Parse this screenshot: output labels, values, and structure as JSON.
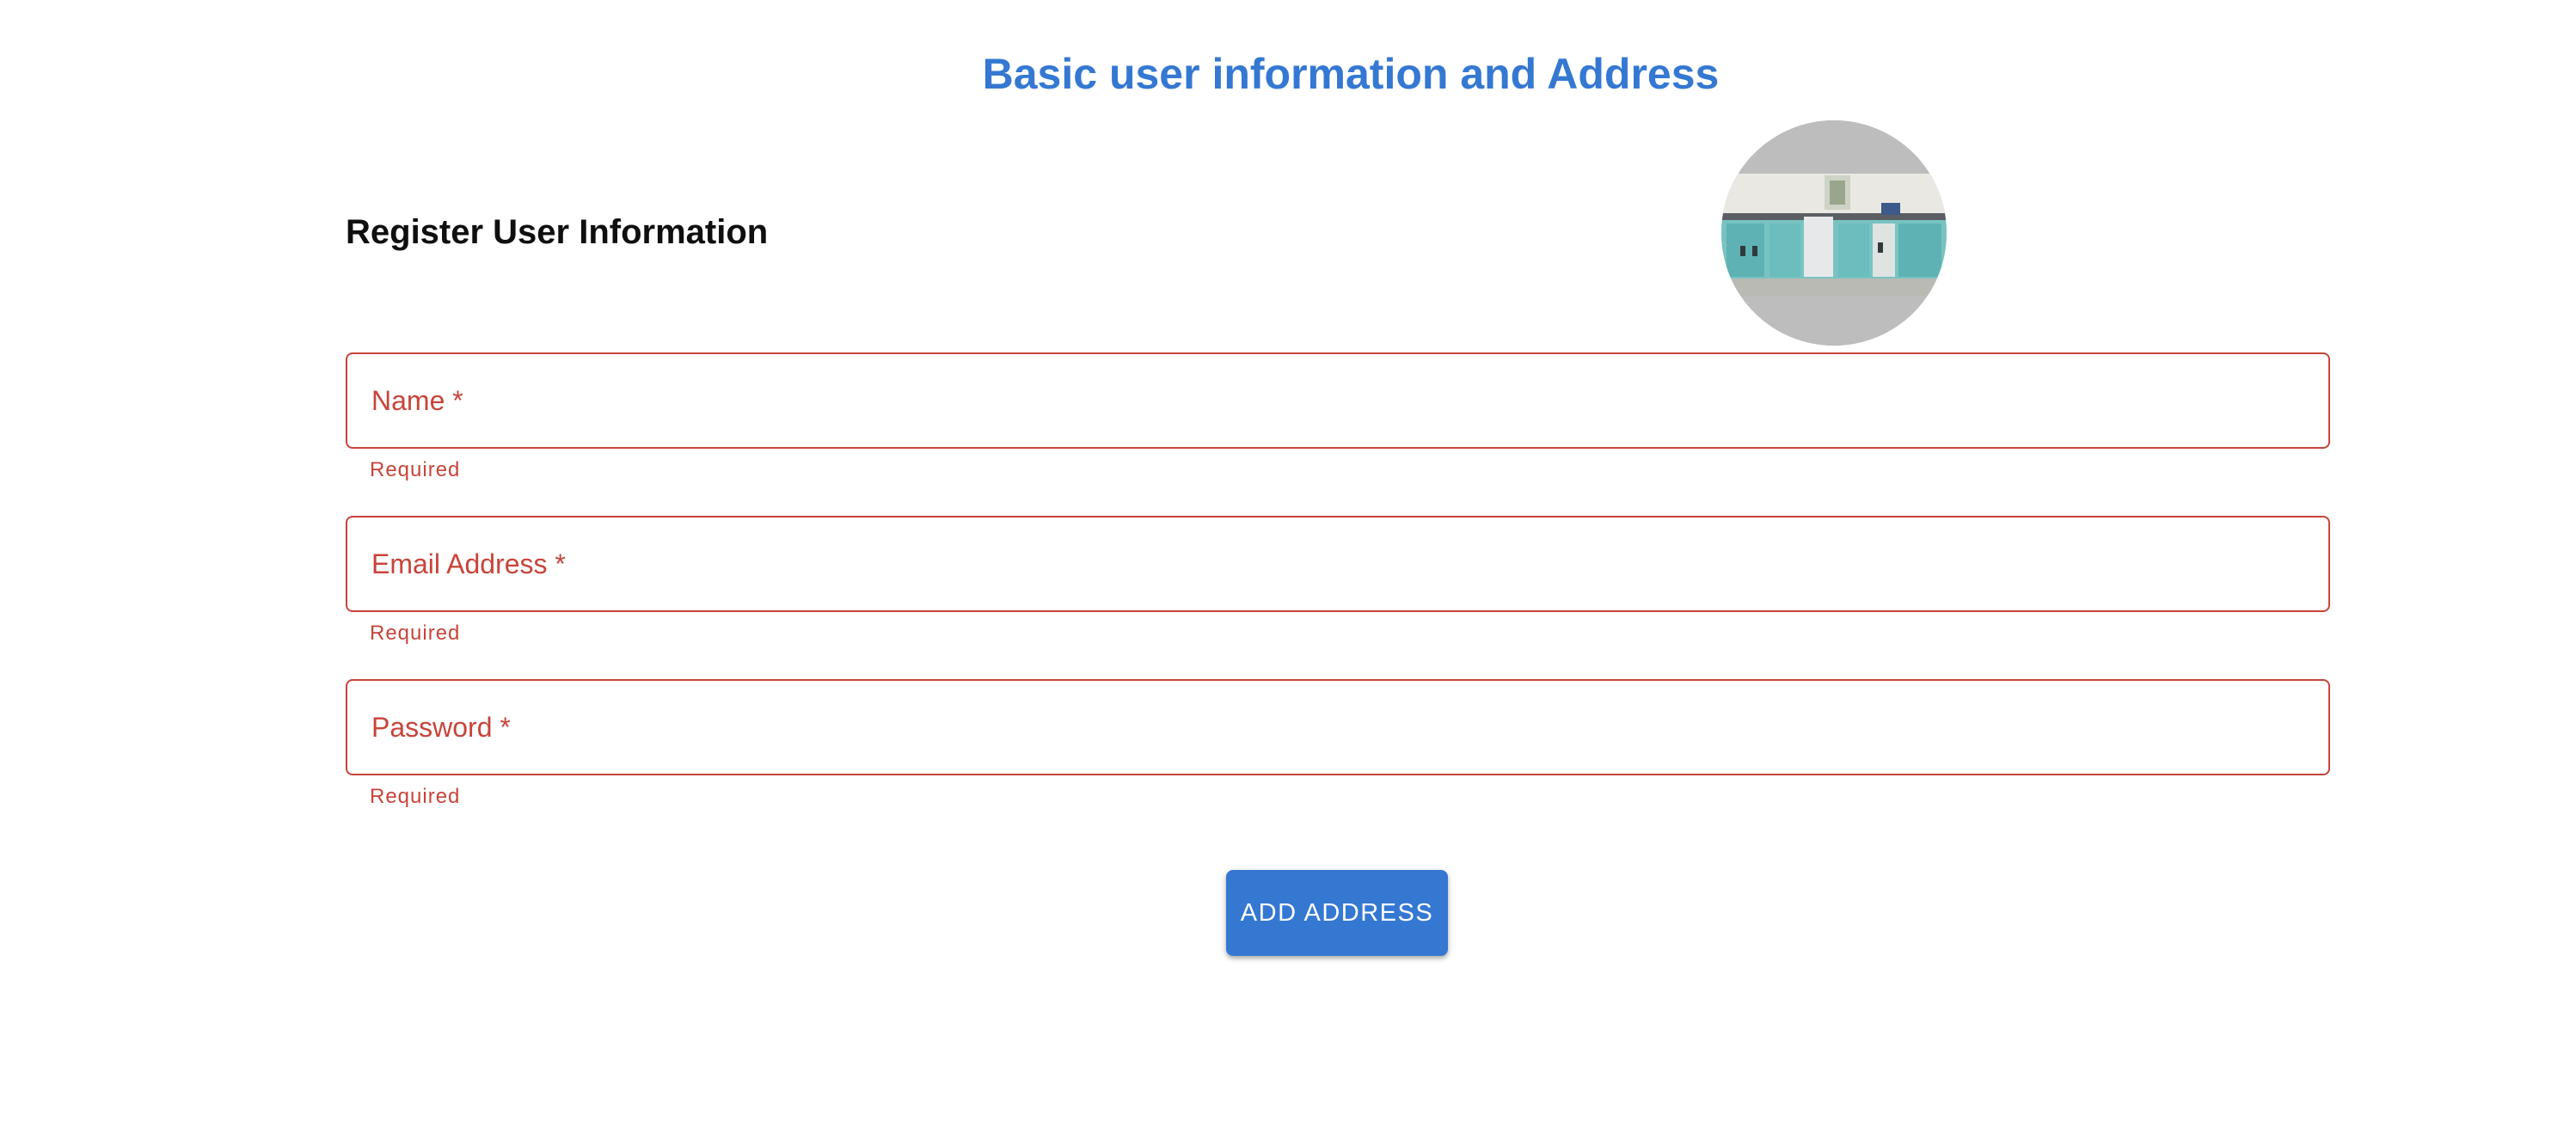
{
  "header": {
    "title": "Basic user information and Address"
  },
  "form": {
    "section_title": "Register User Information",
    "avatar_icon": "profile-photo-kitchen",
    "fields": [
      {
        "label": "Name *",
        "value": "",
        "helper": "Required"
      },
      {
        "label": "Email Address *",
        "value": "",
        "helper": "Required"
      },
      {
        "label": "Password *",
        "value": "",
        "helper": "Required"
      }
    ],
    "add_address_label": "ADD ADDRESS"
  },
  "colors": {
    "accent": "#3478d2",
    "error": "#c8443a",
    "avatar_bg": "#bdbdbd"
  }
}
